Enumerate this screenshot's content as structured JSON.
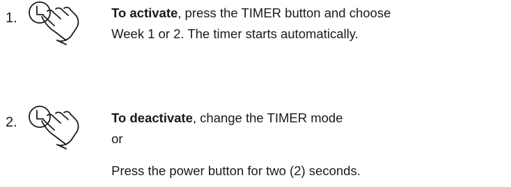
{
  "steps": [
    {
      "number": "1.",
      "icon": "timer-hand-press-icon",
      "lead": "To activate",
      "line1_rest": ", press the TIMER button and choose",
      "line2": "Week 1 or 2. The timer starts automatically."
    },
    {
      "number": "2.",
      "icon": "timer-hand-press-icon",
      "lead": "To deactivate",
      "line1_rest": ", change the TIMER mode",
      "line2": "or",
      "line3": "Press the power button for two (2) seconds."
    }
  ]
}
